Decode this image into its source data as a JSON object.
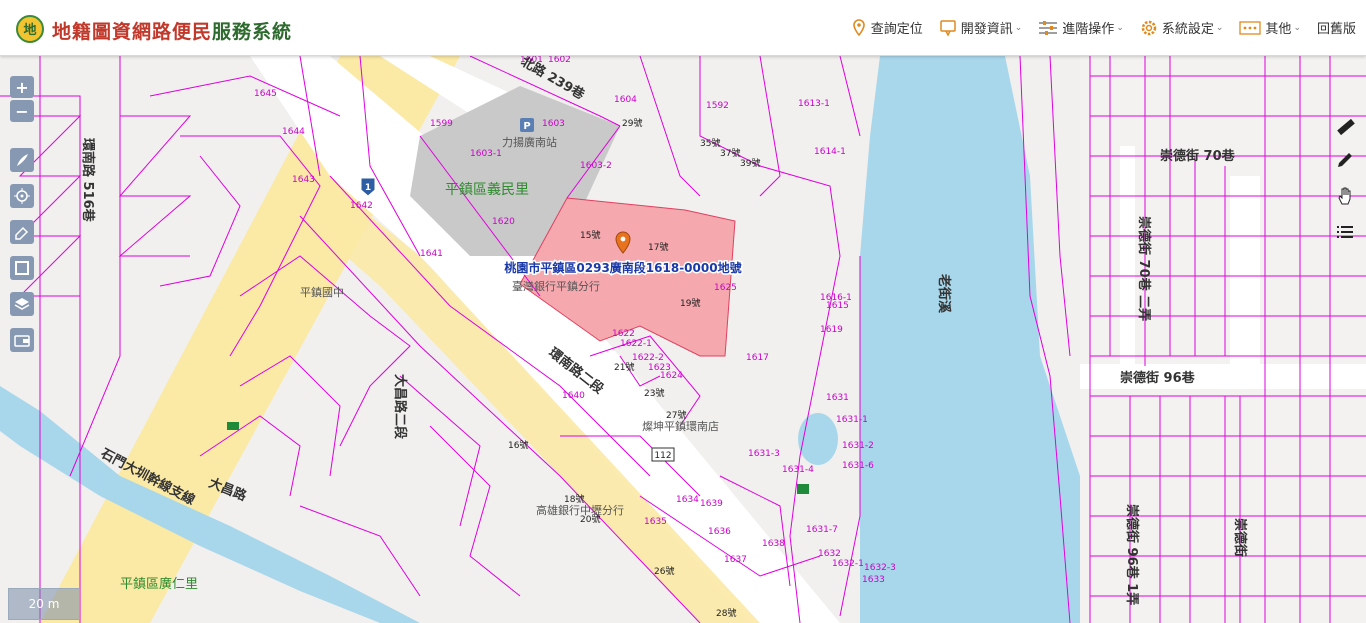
{
  "header": {
    "brand_part1": "地籍圖資網路便民",
    "brand_part2": "服務系統",
    "nav": [
      {
        "label": "查詢定位",
        "icon": "location-pin-icon"
      },
      {
        "label": "開發資訊",
        "icon": "info-pin-icon",
        "dropdown": true
      },
      {
        "label": "進階操作",
        "icon": "sliders-icon",
        "dropdown": true
      },
      {
        "label": "系統設定",
        "icon": "gear-icon",
        "dropdown": true
      },
      {
        "label": "其他",
        "icon": "more-dots-icon",
        "dropdown": true
      },
      {
        "label": "回舊版"
      }
    ]
  },
  "map": {
    "scale_label": "20 m",
    "highlight_label": "桃園市平鎮區0293廣南段1618-0000地號",
    "area_labels": [
      {
        "name": "village-yimin",
        "text": "平鎮區義民里"
      },
      {
        "name": "village-guangren",
        "text": "平鎮區廣仁里"
      }
    ],
    "road_labels": [
      {
        "name": "road-lane239",
        "text": "北路 239巷"
      },
      {
        "name": "road-huannan",
        "text": "環南路二段"
      },
      {
        "name": "road-huannan516",
        "text": "環南路 516巷"
      },
      {
        "name": "road-dachang",
        "text": "大昌路"
      },
      {
        "name": "road-dachang2",
        "text": "大昌路二段"
      },
      {
        "name": "road-shimen",
        "text": "石門大圳幹線支線"
      },
      {
        "name": "road-chongde70",
        "text": "崇德街 70巷"
      },
      {
        "name": "road-chongde96",
        "text": "崇德街 96巷"
      },
      {
        "name": "road-chongde70-lane",
        "text": "崇德街 70巷 二弄"
      },
      {
        "name": "road-chongde96-1",
        "text": "崇德街 96巷 1弄"
      },
      {
        "name": "road-chongde-v",
        "text": "崇德街"
      },
      {
        "name": "river-laojie",
        "text": "老街溪"
      }
    ],
    "poi_labels": [
      {
        "name": "poi-parking",
        "text": "力揚廣南站"
      },
      {
        "name": "poi-bank",
        "text": "臺灣銀行平鎮分行"
      },
      {
        "name": "poi-store",
        "text": "燦坤平鎮環南店"
      },
      {
        "name": "poi-bank2",
        "text": "高雄銀行中壢分行"
      },
      {
        "name": "poi-school",
        "text": "平鎮國中"
      }
    ],
    "route_shield": "1",
    "route_shield2": "112",
    "parcel_labels": [
      "1601",
      "1602",
      "1603",
      "1603-1",
      "1603-2",
      "1604",
      "1592",
      "1613-1",
      "1614-1",
      "1599",
      "1620",
      "1641",
      "1642",
      "1643",
      "1644",
      "1645",
      "1622",
      "1622-1",
      "1622-2",
      "1623",
      "1624",
      "1625",
      "1616-1",
      "1615",
      "1619",
      "1617",
      "1640",
      "1631",
      "1631-1",
      "1631-2",
      "1631-3",
      "1631-4",
      "1631-6",
      "1631-7",
      "1632",
      "1632-1",
      "1632-3",
      "1633",
      "1634",
      "1635",
      "1636",
      "1637",
      "1638",
      "1639"
    ],
    "building_labels": [
      "15號",
      "17號",
      "19號",
      "21號",
      "23號",
      "27號",
      "29號",
      "35號",
      "37號",
      "39號",
      "16號",
      "18號",
      "20號",
      "26號",
      "28號"
    ],
    "colors": {
      "parcel_line": "#e000e0",
      "highlight_fill": "#f5a8ae",
      "river": "#a8d7eb",
      "road_yellow": "#fbe9a6",
      "block": "#eeebe8"
    }
  }
}
